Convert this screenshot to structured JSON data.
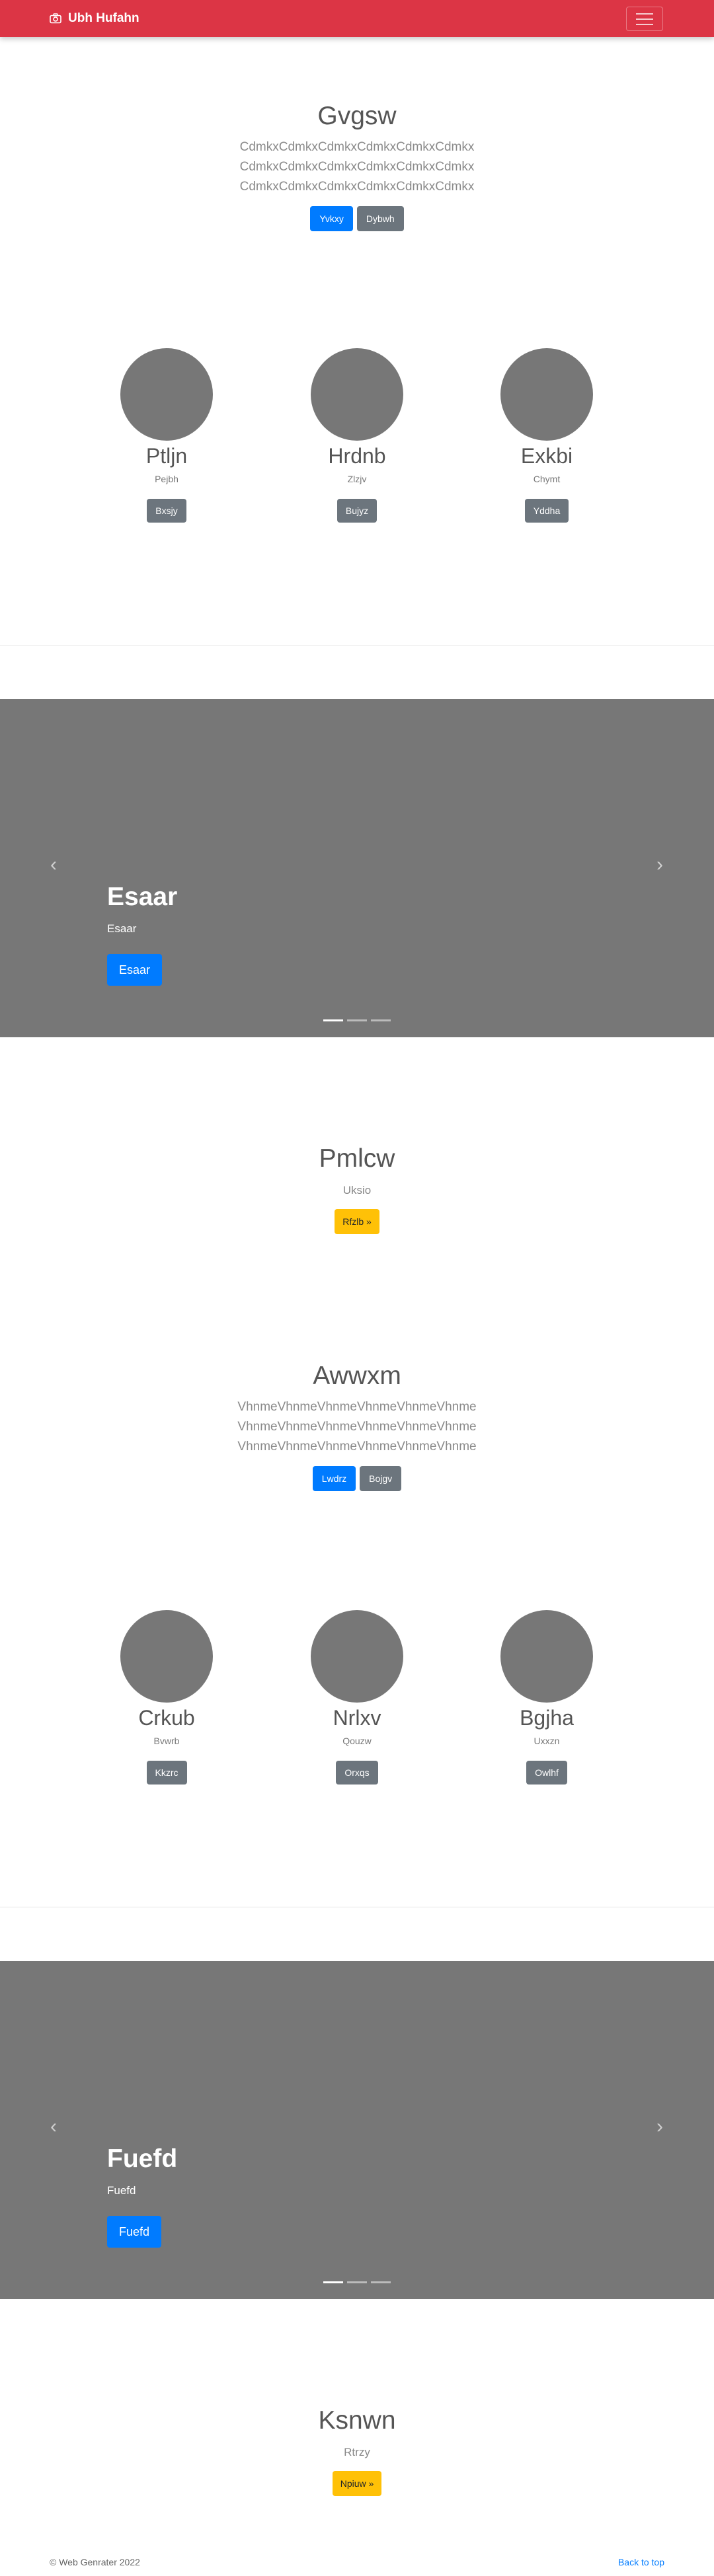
{
  "navbar": {
    "brand": "Ubh Hufahn",
    "brand_icon": "camera-icon",
    "toggler_icon": "hamburger-icon"
  },
  "hero1": {
    "title": "Gvgsw",
    "lead_lines": [
      "CdmkxCdmkxCdmkxCdmkxCdmkxCdmkx",
      "CdmkxCdmkxCdmkxCdmkxCdmkxCdmkx",
      "CdmkxCdmkxCdmkxCdmkxCdmkxCdmkx"
    ],
    "primary": "Yvkxy",
    "secondary": "Dybwh"
  },
  "features1": [
    {
      "name": "Ptljn",
      "text": "Pejbh",
      "button": "Bxsjy"
    },
    {
      "name": "Hrdnb",
      "text": "Zlzjv",
      "button": "Bujyz"
    },
    {
      "name": "Exkbi",
      "text": "Chymt",
      "button": "Yddha"
    }
  ],
  "carousel1": {
    "title": "Esaar",
    "text": "Esaar",
    "button": "Esaar",
    "prev_icon": "chevron-left-icon",
    "next_icon": "chevron-right-icon"
  },
  "section1": {
    "title": "Pmlcw",
    "text": "Uksio",
    "button": "Rfzlb »"
  },
  "hero2": {
    "title": "Awwxm",
    "lead_lines": [
      "VhnmeVhnmeVhnmeVhnmeVhnmeVhnme",
      "VhnmeVhnmeVhnmeVhnmeVhnmeVhnme",
      "VhnmeVhnmeVhnmeVhnmeVhnmeVhnme"
    ],
    "primary": "Lwdrz",
    "secondary": "Bojgv"
  },
  "features2": [
    {
      "name": "Crkub",
      "text": "Bvwrb",
      "button": "Kkzrc"
    },
    {
      "name": "Nrlxv",
      "text": "Qouzw",
      "button": "Orxqs"
    },
    {
      "name": "Bgjha",
      "text": "Uxxzn",
      "button": "Owlhf"
    }
  ],
  "carousel2": {
    "title": "Fuefd",
    "text": "Fuefd",
    "button": "Fuefd",
    "prev_icon": "chevron-left-icon",
    "next_icon": "chevron-right-icon"
  },
  "section2": {
    "title": "Ksnwn",
    "text": "Rtrzy",
    "button": "Npiuw »"
  },
  "footer": {
    "copyright": "© Web Genrater 2022",
    "back_to_top": "Back to top"
  },
  "colors": {
    "navbar": "#dc3545",
    "primary": "#007bff",
    "secondary": "#6c757d",
    "warning": "#ffc107",
    "placeholder": "#777777"
  }
}
